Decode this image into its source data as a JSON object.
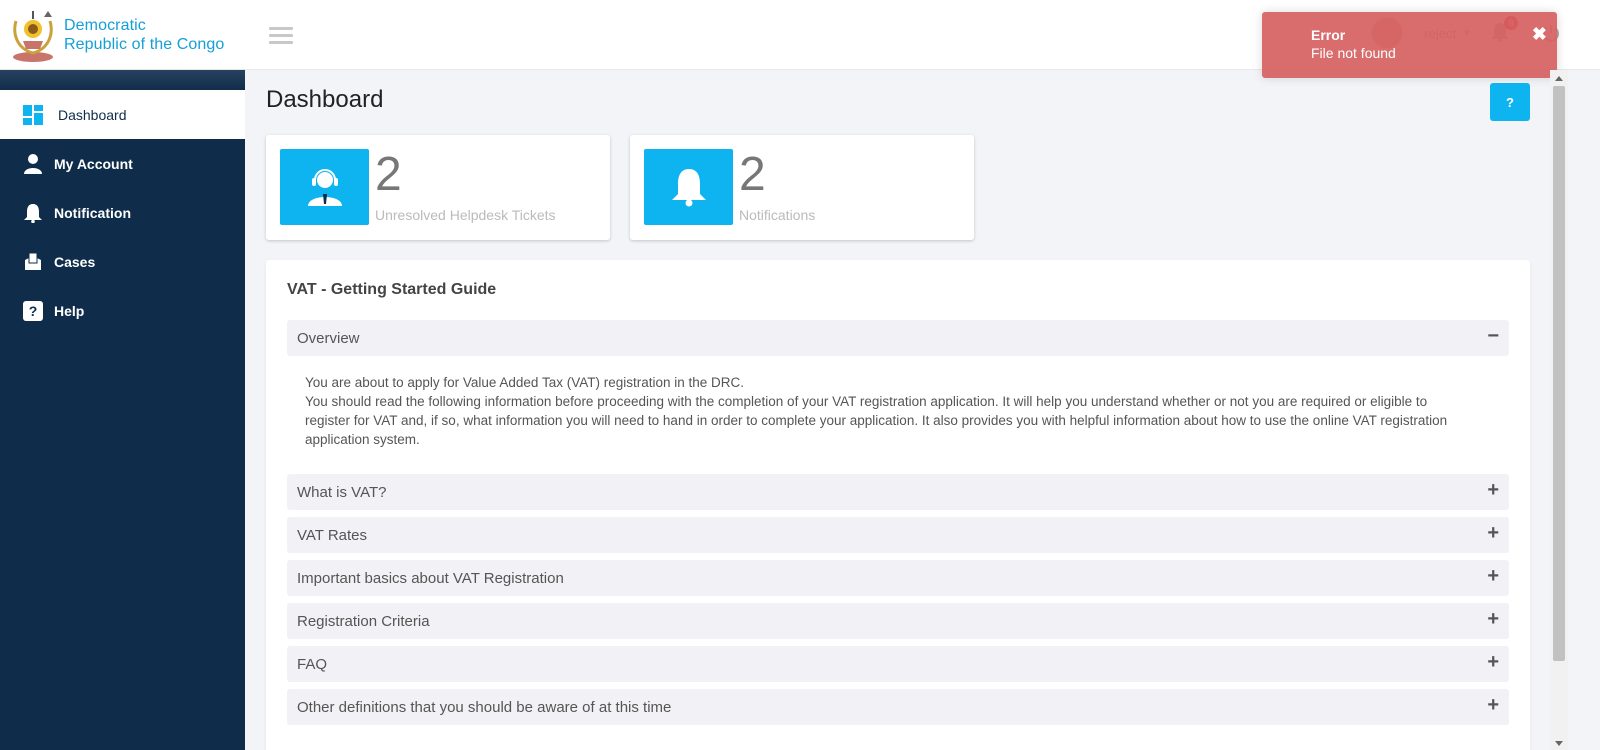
{
  "brand": {
    "title_line1": "Democratic",
    "title_line2": "Republic of the Congo"
  },
  "sidebar": {
    "items": [
      {
        "label": "Dashboard",
        "icon": "dashboard-icon",
        "active": true
      },
      {
        "label": "My Account",
        "icon": "user-icon",
        "active": false
      },
      {
        "label": "Notification",
        "icon": "bell-icon",
        "active": false
      },
      {
        "label": "Cases",
        "icon": "cases-icon",
        "active": false
      },
      {
        "label": "Help",
        "icon": "help-icon",
        "active": false
      }
    ]
  },
  "topbar": {
    "user_name": "reject",
    "notification_count": "8"
  },
  "toast": {
    "title": "Error",
    "message": "File not found"
  },
  "page": {
    "title": "Dashboard",
    "help_label": "?"
  },
  "stats": [
    {
      "value": "2",
      "label": "Unresolved Helpdesk Tickets",
      "icon": "helpdesk-agent-icon"
    },
    {
      "value": "2",
      "label": "Notifications",
      "icon": "bell-icon"
    }
  ],
  "guide": {
    "title": "VAT - Getting Started Guide",
    "sections": [
      {
        "title": "Overview",
        "expanded": true,
        "sign": "−"
      },
      {
        "title": "What is VAT?",
        "expanded": false,
        "sign": "+"
      },
      {
        "title": "VAT Rates",
        "expanded": false,
        "sign": "+"
      },
      {
        "title": "Important basics about VAT Registration",
        "expanded": false,
        "sign": "+"
      },
      {
        "title": "Registration Criteria",
        "expanded": false,
        "sign": "+"
      },
      {
        "title": "FAQ",
        "expanded": false,
        "sign": "+"
      },
      {
        "title": "Other definitions that you should be aware of at this time",
        "expanded": false,
        "sign": "+"
      }
    ],
    "overview_text_1": "You are about to apply for Value Added Tax (VAT) registration in the DRC.",
    "overview_text_2": "You should read the following information before proceeding with the completion of your VAT registration application. It will help you understand whether or not you are required or eligible to register for VAT and, if so, what information you will need to hand in order to complete your application. It also provides you with helpful information about how to use the online VAT registration application system."
  },
  "colors": {
    "sidebar": "#0f2d4b",
    "accent": "#0eb4f0",
    "toast": "#d65f5f",
    "brand_text": "#14a0d6"
  }
}
